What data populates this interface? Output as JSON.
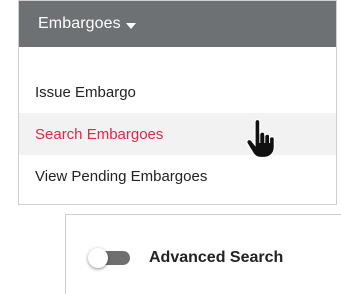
{
  "menu": {
    "header_label": "Embargoes",
    "header_bg": "#6e7173",
    "items": [
      {
        "label": "Issue Embargo"
      },
      {
        "label": "Search Embargoes",
        "active": true
      },
      {
        "label": "View Pending Embargoes"
      }
    ],
    "active_color": "#e2264d"
  },
  "advanced_search": {
    "label": "Advanced Search",
    "toggle_on": false
  },
  "cursor": {
    "icon": "hand-pointer-icon"
  }
}
